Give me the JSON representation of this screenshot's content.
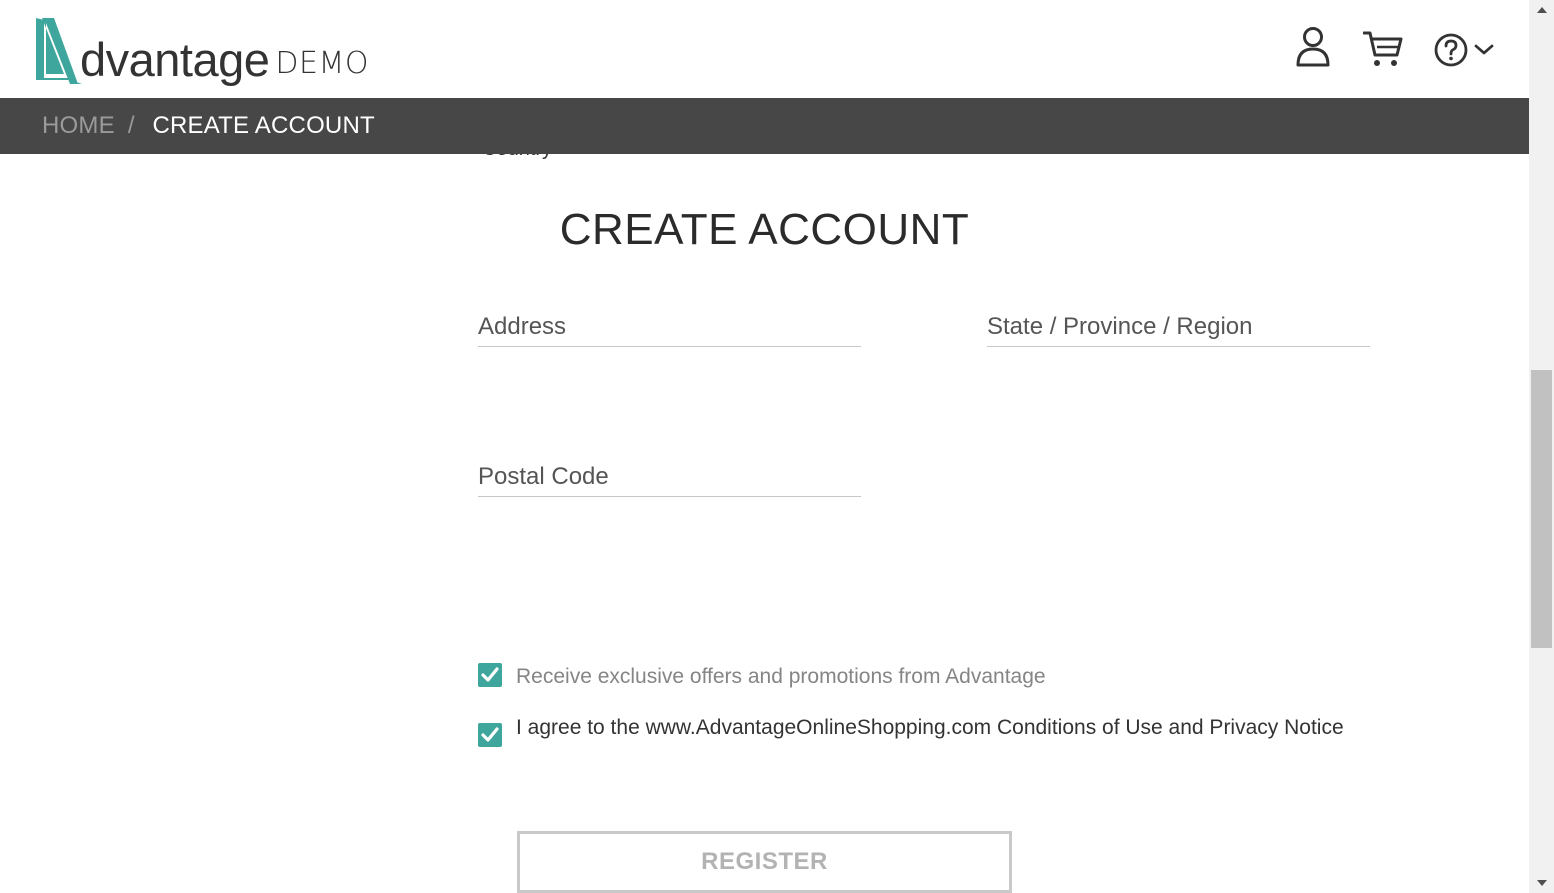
{
  "header": {
    "logo_word": "dvantage",
    "logo_suffix": "DEMO",
    "icons": [
      "user-icon",
      "cart-icon",
      "help-icon",
      "chevron-down-icon"
    ]
  },
  "breadcrumb": {
    "home": "HOME",
    "separator": "/",
    "current": "CREATE ACCOUNT"
  },
  "form": {
    "peek_text": "Country",
    "title": "CREATE ACCOUNT",
    "address_placeholder": "Address",
    "state_placeholder": "State / Province / Region",
    "postal_placeholder": "Postal Code",
    "offers_label": "Receive exclusive offers and promotions from Advantage",
    "offers_checked": true,
    "agree_label": "I agree to the www.AdvantageOnlineShopping.com Conditions of Use and Privacy Notice",
    "agree_checked": true,
    "register_label": "REGISTER"
  },
  "colors": {
    "brand_teal": "#3ea69c",
    "breadcrumb_bar": "#474747",
    "text_dark": "#333333",
    "register_disabled": "#b3b3b3"
  }
}
